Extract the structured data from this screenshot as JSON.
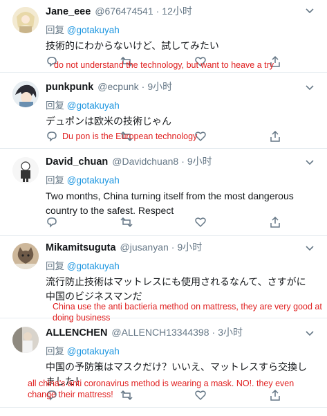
{
  "tweets": [
    {
      "name": "Jane_eee",
      "handle": "@676474541",
      "time": "12小时",
      "reply_prefix": "回复",
      "reply_to": "@gotakuyah",
      "text": "技術的にわからないけど、試してみたい",
      "annotation": "do not understand the technology, but want to heave a try",
      "avatar_icon": "anime-character-avatar"
    },
    {
      "name": "punkpunk",
      "handle": "@ecpunk",
      "time": "9小时",
      "reply_prefix": "回复",
      "reply_to": "@gotakuyah",
      "text": "デュポンは欧米の技術じゃん",
      "annotation": "Du pon is the European technology",
      "avatar_icon": "anime-character-avatar"
    },
    {
      "name": "David_chuan",
      "handle": "@Davidchuan8",
      "time": "9小时",
      "reply_prefix": "回复",
      "reply_to": "@gotakuyah",
      "text": "Two months, China turning itself from the most dangerous country to the safest. Respect",
      "avatar_icon": "cartoon-figure-avatar"
    },
    {
      "name": "Mikamitsuguta",
      "handle": "@jusanyan",
      "time": "9小时",
      "reply_prefix": "回复",
      "reply_to": "@gotakuyah",
      "text": "流行防止技術はマットレスにも使用されるなんて、さすがに中国のビジネスマンだ",
      "annotation": "China use the anti bactieria method on mattress, they are very good at doing business",
      "avatar_icon": "cat-avatar"
    },
    {
      "name": "ALLENCHEN",
      "handle": "@ALLENCH13344398",
      "time": "3小时",
      "reply_prefix": "回复",
      "reply_to": "@gotakuyah",
      "text": "中国の予防策はマスクだけ？いいえ、マットレスすら交換しました！",
      "annotation": "all china's anti coronavirus method is wearing a mask. NO!. they even change their mattress!",
      "avatar_icon": "person-avatar"
    }
  ],
  "icons": {
    "reply": "reply-icon",
    "retweet": "retweet-icon",
    "like": "like-icon",
    "share": "share-icon",
    "menu": "chevron-down-icon"
  },
  "colors": {
    "annotation": "#e02020",
    "link": "#1b95e0",
    "muted": "#657786"
  }
}
